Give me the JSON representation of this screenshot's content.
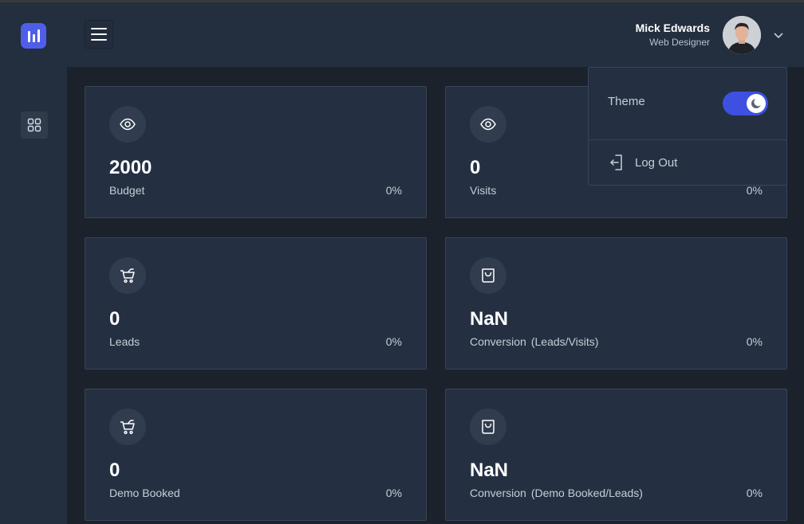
{
  "header": {
    "user_name": "Mick Edwards",
    "user_role": "Web Designer"
  },
  "cards": [
    {
      "value": "2000",
      "label": "Budget",
      "sublabel": "",
      "percent": "0%",
      "icon": "eye-icon"
    },
    {
      "value": "0",
      "label": "Visits",
      "sublabel": "",
      "percent": "0%",
      "icon": "eye-icon"
    },
    {
      "value": "0",
      "label": "Leads",
      "sublabel": "",
      "percent": "0%",
      "icon": "cart-icon"
    },
    {
      "value": "NaN",
      "label": "Conversion",
      "sublabel": "(Leads/Visits)",
      "percent": "0%",
      "icon": "bag-icon"
    },
    {
      "value": "0",
      "label": "Demo Booked",
      "sublabel": "",
      "percent": "0%",
      "icon": "cart-icon"
    },
    {
      "value": "NaN",
      "label": "Conversion",
      "sublabel": "(Demo Booked/Leads)",
      "percent": "0%",
      "icon": "bag-icon"
    }
  ],
  "dropdown": {
    "theme_label": "Theme",
    "theme_dark": true,
    "logout_label": "Log Out"
  },
  "colors": {
    "accent": "#4f5ee9",
    "background": "#1b222c",
    "panel": "#232e3f",
    "card": "#243042"
  }
}
